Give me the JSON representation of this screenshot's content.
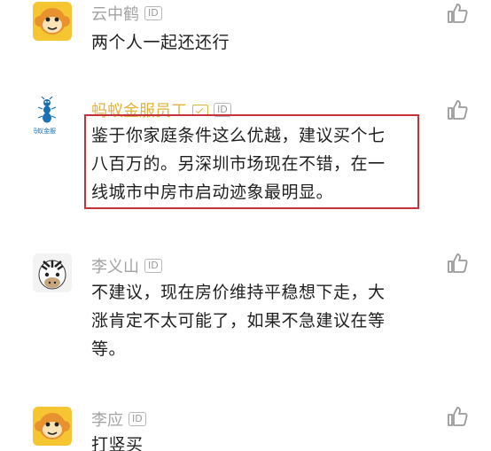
{
  "comments": [
    {
      "name": "云中鹤",
      "id_badge": "ID",
      "text_lines": [
        "两个人一起还还行"
      ],
      "avatar": "monkey-avatar"
    },
    {
      "name": "蚂蚁金服员工",
      "id_badge": "ID",
      "avatar_caption": "蚂蚁金服",
      "text_lines": [
        "鉴于你家庭条件这么优越，建议买个七",
        "八百万的。另深圳市场现在不错，在一",
        "线城市中房市启动迹象最明显。"
      ],
      "avatar": "ant-avatar",
      "highlighted": true
    },
    {
      "name": "李义山",
      "id_badge": "ID",
      "text_lines": [
        "不建议，现在房价维持平稳想下走，大",
        "涨肯定不太可能了，如果不急建议在等",
        "等。"
      ],
      "avatar": "zebra-avatar"
    },
    {
      "name": "李应",
      "id_badge": "ID",
      "text_lines": [
        "打竖买"
      ],
      "avatar": "monkey-avatar"
    }
  ],
  "colors": {
    "highlight": "#c7313a",
    "gold_name": "#e2b23b",
    "gray_name": "#a3a3a3",
    "avatar_yellow": "#f5c632"
  },
  "icons": [
    "thumbs-up-icon",
    "id-badge-icon",
    "verified-badge-icon"
  ]
}
